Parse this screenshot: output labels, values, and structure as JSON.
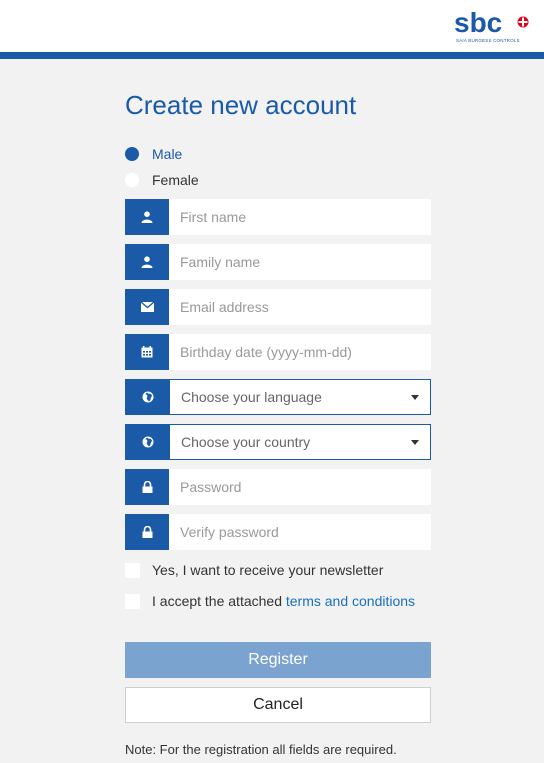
{
  "header": {
    "logo_text": "sbc",
    "logo_subtext": "SAIA BURGESS CONTROLS"
  },
  "form": {
    "title": "Create new account",
    "gender": {
      "options": [
        "Male",
        "Female"
      ],
      "selected": "Male"
    },
    "fields": {
      "first_name": "First name",
      "family_name": "Family name",
      "email": "Email address",
      "birthday": "Birthday date (yyyy-mm-dd)",
      "language": "Choose your language",
      "country": "Choose your country",
      "password": "Password",
      "verify_password": "Verify password"
    },
    "newsletter_label": "Yes, I want to receive your newsletter",
    "terms_prefix": "I accept the attached ",
    "terms_link": "terms and conditions",
    "register_label": "Register",
    "cancel_label": "Cancel",
    "note": "Note: For the registration all fields are required."
  },
  "colors": {
    "brand_blue": "#1a5aa7",
    "register_button": "#7ba3cf",
    "background": "#f2f2f2"
  },
  "icons": {
    "first_name": "user-icon",
    "family_name": "user-icon",
    "email": "envelope-icon",
    "birthday": "calendar-icon",
    "language": "globe-icon",
    "country": "globe-icon",
    "password": "lock-icon",
    "verify_password": "lock-icon",
    "dropdown": "caret-down-icon"
  }
}
